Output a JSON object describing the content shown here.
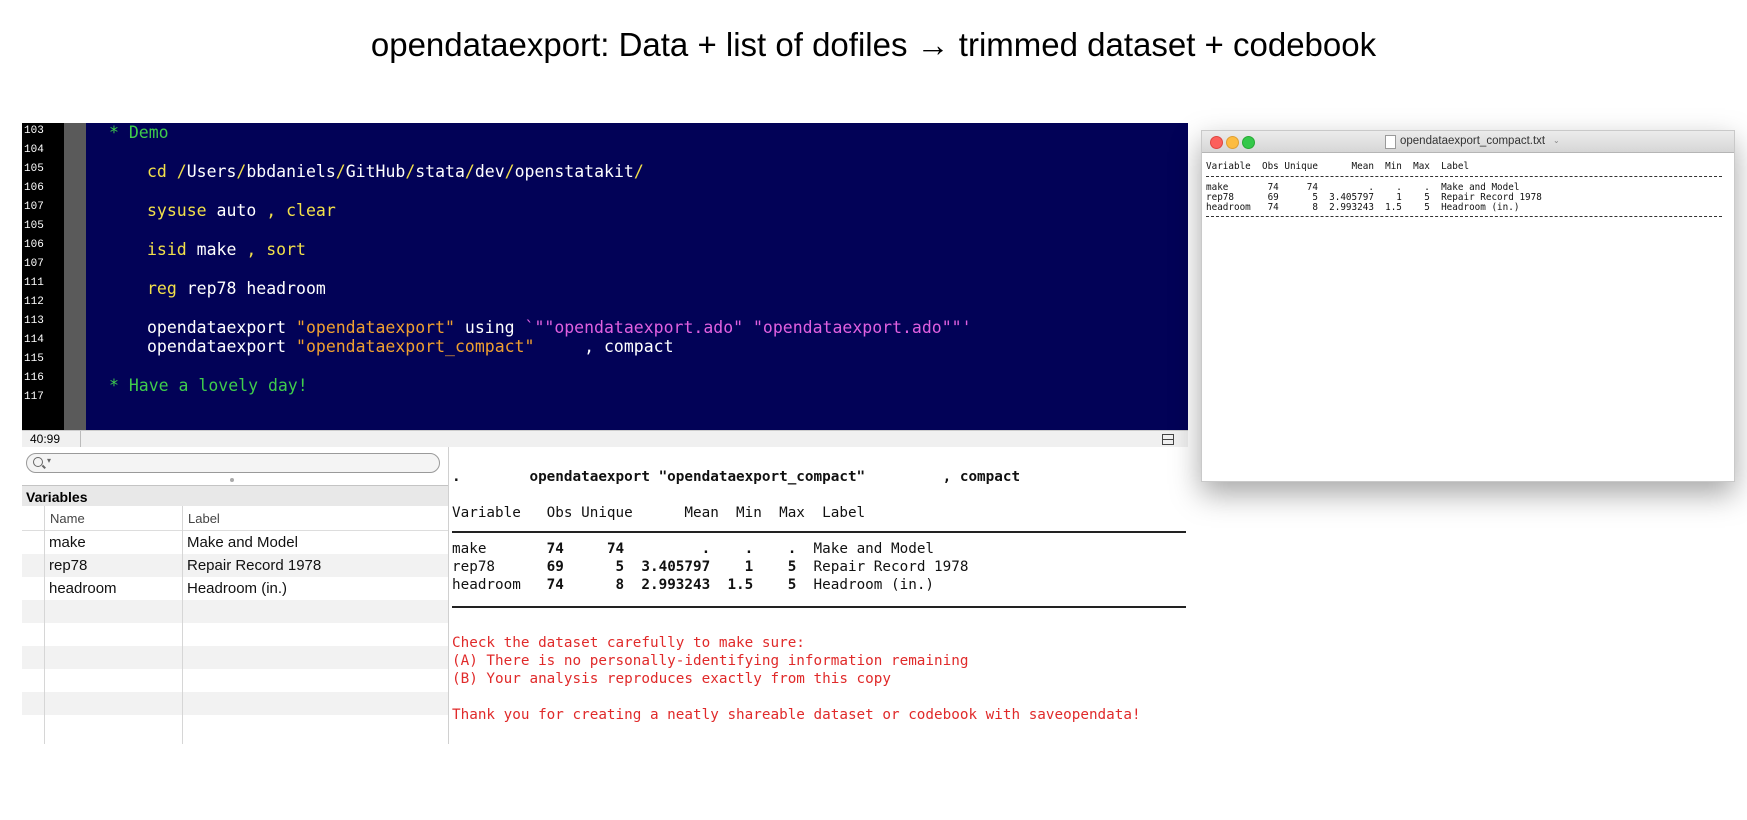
{
  "slide": {
    "title": "opendataexport: Data + list of dofiles → trimmed dataset + codebook"
  },
  "editor": {
    "line_numbers": [
      "103",
      "104",
      "105",
      "106",
      "107",
      "105",
      "106",
      "107",
      "111",
      "112",
      "113",
      "114",
      "115",
      "116",
      "117"
    ],
    "lines": {
      "demo_comment": "* Demo",
      "cd_cmd": "cd",
      "cd_path_1": " /",
      "cd_path_2": "Users",
      "cd_path_3": "/",
      "cd_path_4": "bbdaniels",
      "cd_path_5": "/",
      "cd_path_6": "GitHub",
      "cd_path_7": "/",
      "cd_path_8": "stata",
      "cd_path_9": "/",
      "cd_path_10": "dev",
      "cd_path_11": "/",
      "cd_path_12": "openstatakit",
      "cd_path_13": "/",
      "sysuse_kw": "sysuse",
      "sysuse_arg": " auto ",
      "sysuse_opt": ", clear",
      "isid_kw": "isid",
      "isid_arg": " make ",
      "isid_opt": ", sort",
      "reg_kw": "reg",
      "reg_arg": " rep78 headroom",
      "ode1_cmd": "opendataexport ",
      "ode1_str": "\"opendataexport\"",
      "ode1_using": " using ",
      "ode1_files": "`\"\"opendataexport.ado\" \"opendataexport.ado\"\"'",
      "ode2_cmd": "opendataexport ",
      "ode2_str": "\"opendataexport_compact\"",
      "ode2_opt": "     , compact",
      "bye_comment": "* Have a lovely day!"
    }
  },
  "statusbar": {
    "position": "40:99"
  },
  "variables_panel": {
    "header": "Variables",
    "columns": [
      "Name",
      "Label"
    ],
    "rows": [
      {
        "name": "make",
        "label": "Make and Model"
      },
      {
        "name": "rep78",
        "label": "Repair Record 1978"
      },
      {
        "name": "headroom",
        "label": "Headroom (in.)"
      }
    ]
  },
  "results": {
    "command_line": ".        opendataexport \"opendataexport_compact\"         , compact",
    "header_line": "Variable   Obs Unique      Mean  Min  Max  Label",
    "rows": [
      {
        "left": "make      ",
        "nums": " 74     74         .    .    .",
        "label": "  Make and Model"
      },
      {
        "left": "rep78     ",
        "nums": " 69      5  3.405797    1    5",
        "label": "  Repair Record 1978"
      },
      {
        "left": "headroom  ",
        "nums": " 74      8  2.993243  1.5    5",
        "label": "  Headroom (in.)"
      }
    ],
    "messages": [
      "Check the dataset carefully to make sure:",
      "(A) There is no personally-identifying information remaining",
      "(B) Your analysis reproduces exactly from this copy",
      "Thank you for creating a neatly shareable dataset or codebook with saveopendata!"
    ]
  },
  "text_window": {
    "title": "opendataexport_compact.txt",
    "header_line": "Variable  Obs Unique      Mean  Min  Max  Label",
    "rows": [
      "make       74     74         .    .    .  Make and Model",
      "rep78      69      5  3.405797    1    5  Repair Record 1978",
      "headroom   74      8  2.993243  1.5    5  Headroom (in.)"
    ]
  }
}
